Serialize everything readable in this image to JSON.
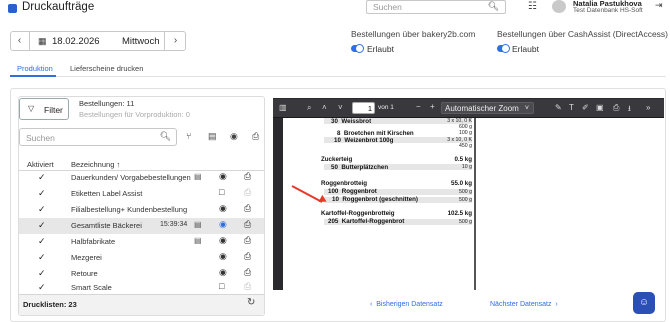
{
  "header": {
    "app_title": "Druckaufträge",
    "search_placeholder": "Suchen",
    "user_name": "Natalia Pastukhova",
    "user_org": "Test Datenbank HS-Soft"
  },
  "date_nav": {
    "date": "18.02.2026",
    "weekday": "Mittwoch"
  },
  "switches": [
    {
      "label": "Bestellungen über bakery2b.com",
      "value": "Erlaubt"
    },
    {
      "label": "Bestellungen über CashAssist (DirectAccess)",
      "value": "Erlaubt"
    }
  ],
  "tabs": [
    {
      "label": "Produktion",
      "active": true
    },
    {
      "label": "Lieferscheine drucken",
      "active": false
    }
  ],
  "left": {
    "filter_label": "Filter",
    "count_label": "Bestellungen: 11",
    "count_sub": "Bestellungen für Vorproduktion: 0",
    "search_placeholder": "Suchen",
    "col_active": "Aktiviert",
    "col_name": "Bezeichnung ↑",
    "rows": [
      {
        "label": "Dauerkunden/ Vorgabebestellungen",
        "time": "",
        "checked": true
      },
      {
        "label": "Etiketten Label Assist",
        "time": "",
        "checked": true
      },
      {
        "label": "Filialbestellung+ Kundenbestellung",
        "time": "",
        "checked": true
      },
      {
        "label": "Gesamtliste Bäckerei",
        "time": "15:39:34",
        "checked": true
      },
      {
        "label": "Halbfabrikate",
        "time": "",
        "checked": true
      },
      {
        "label": "Mezgerei",
        "time": "",
        "checked": true
      },
      {
        "label": "Retoure",
        "time": "",
        "checked": true
      },
      {
        "label": "Smart Scale",
        "time": "",
        "checked": true
      }
    ],
    "footer": "Drucklisten: 23"
  },
  "pdf": {
    "page": "1",
    "of": "von 1",
    "zoom": "Automatischer Zoom",
    "lines": [
      {
        "qty": "30",
        "name": "Weissbrot",
        "right": "3 x 10, 0 K",
        "right2": "600 g"
      },
      {
        "qty": "8",
        "name": "Broetchen mit Kirschen",
        "right": "100 g",
        "right2": ""
      },
      {
        "qty": "10",
        "name": "Weizenbrot 100g",
        "right": "3 x 10, 0 K",
        "right2": "450 g"
      }
    ],
    "group1_title": "Zuckerteig",
    "group1_total": "0.5 kg",
    "group1_items": [
      {
        "qty": "50",
        "name": "Butterplätzchen",
        "right": "10 g"
      }
    ],
    "group2_title": "Roggenbrotteig",
    "group2_total": "55.0 kg",
    "group2_items": [
      {
        "qty": "100",
        "name": "Roggenbrot",
        "right": "500 g"
      },
      {
        "qty": "10",
        "name": "Roggenbrot (geschnitten)",
        "right": "500 g"
      }
    ],
    "group3_title": "Kartoffel-Roggenbrotteig",
    "group3_total": "102.5 kg",
    "group3_items": [
      {
        "qty": "205",
        "name": "Kartoffel-Roggenbrot",
        "right": "500 g"
      }
    ],
    "prev_label": "Bisherigen Datensatz",
    "next_label": "Nächster Datensatz"
  },
  "colors": {
    "accent": "#2f6fe0",
    "arrow": "#e53a2b"
  }
}
